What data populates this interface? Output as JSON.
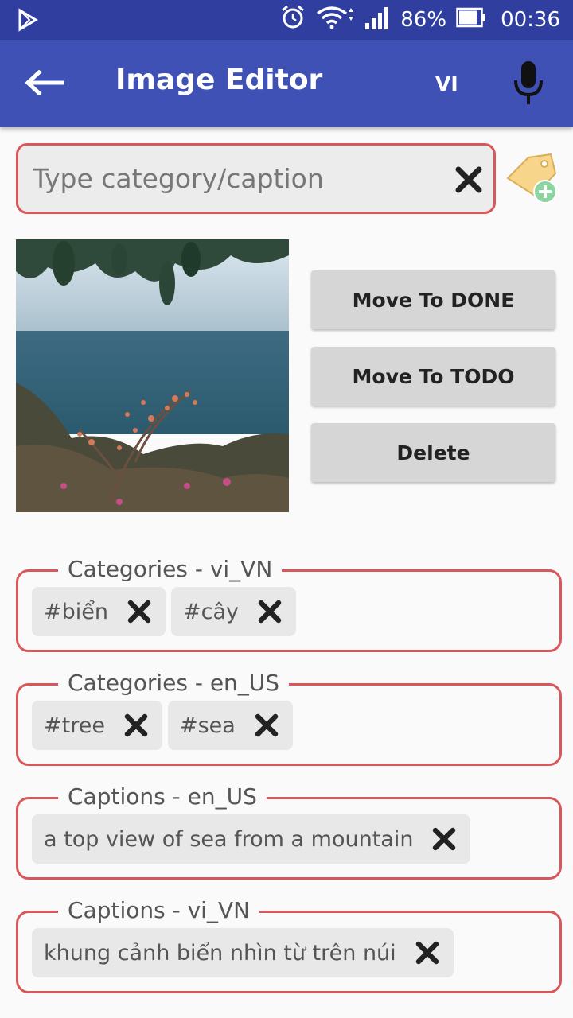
{
  "status_bar": {
    "battery": "86%",
    "time": "00:36"
  },
  "app_bar": {
    "title": "Image Editor",
    "language": "VI"
  },
  "search": {
    "placeholder": "Type category/caption",
    "value": ""
  },
  "actions": {
    "move_done": "Move To DONE",
    "move_todo": "Move To TODO",
    "delete": "Delete"
  },
  "groups": [
    {
      "label": "Categories - vi_VN",
      "chips": [
        "#biển",
        "#cây"
      ]
    },
    {
      "label": "Categories - en_US",
      "chips": [
        "#tree",
        "#sea"
      ]
    },
    {
      "label": "Captions - en_US",
      "chips": [
        "a top view of sea from a mountain"
      ]
    },
    {
      "label": "Captions - vi_VN",
      "chips": [
        "khung cảnh biển nhìn từ trên núi"
      ]
    }
  ],
  "colors": {
    "primary": "#3f51b5",
    "primary_dark": "#303f9f",
    "accent_border": "#d7575a"
  }
}
